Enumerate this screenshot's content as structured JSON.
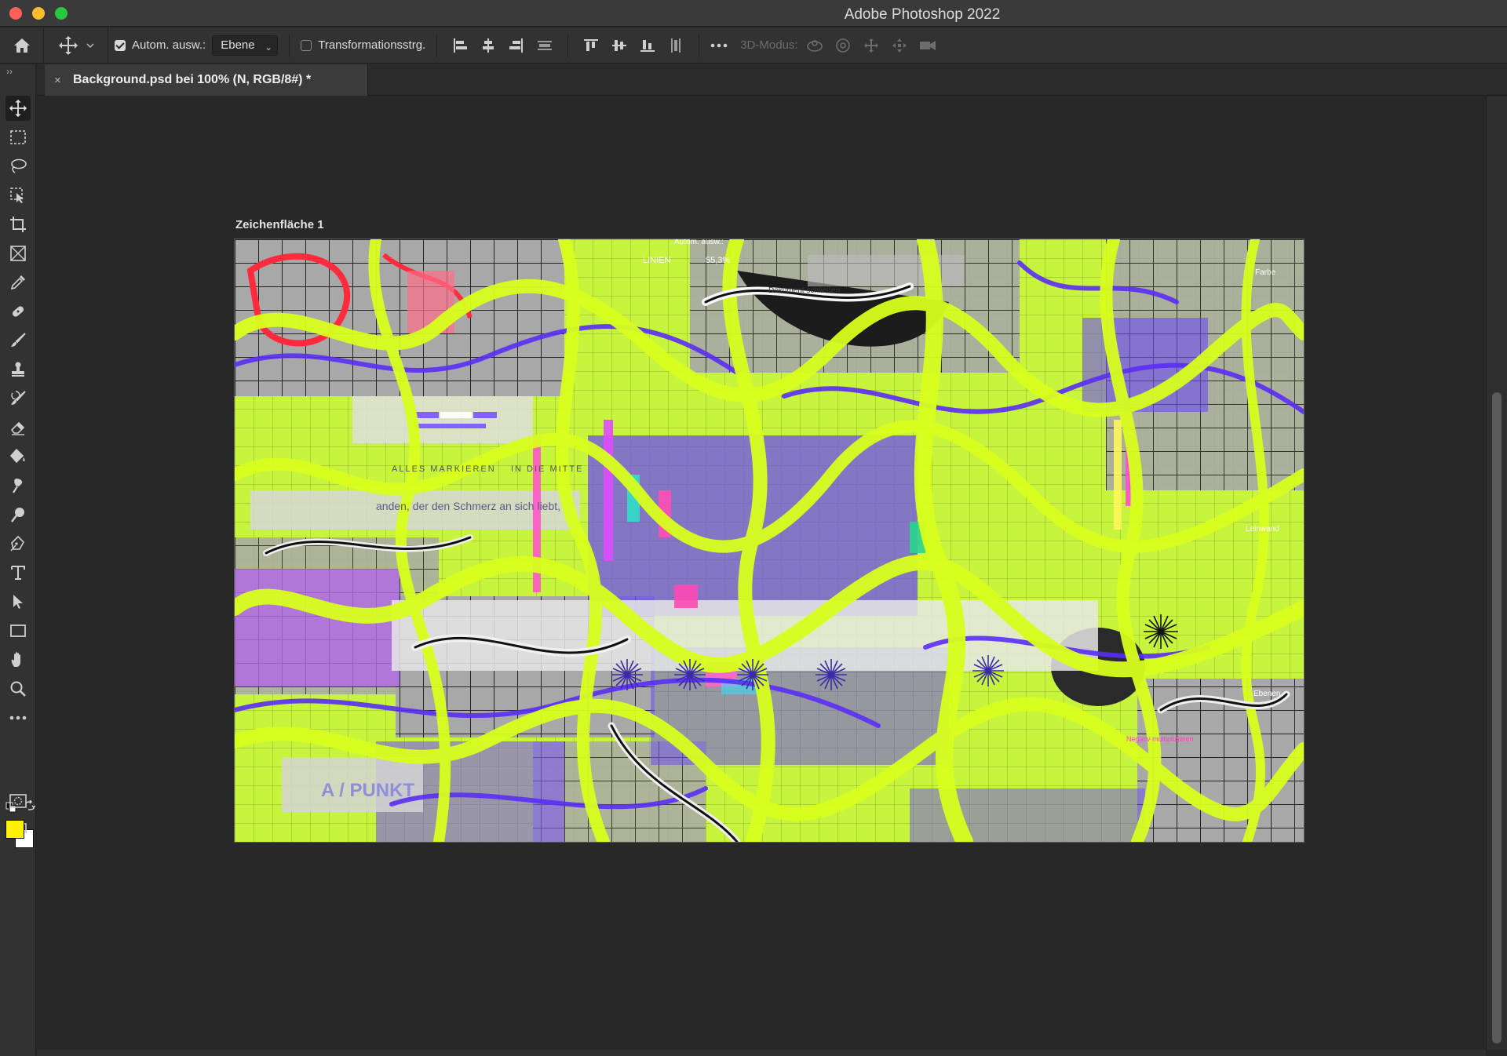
{
  "window": {
    "title": "Adobe Photoshop 2022"
  },
  "options_bar": {
    "auto_select_label": "Autom. ausw.:",
    "auto_select_checked": true,
    "layer_select_value": "Ebene",
    "transform_label": "Transformationsstrg.",
    "transform_checked": false,
    "mode_3d_label": "3D-Modus:"
  },
  "tabs": [
    {
      "label": "Background.psd bei 100% (N, RGB/8#) *",
      "close": "×"
    }
  ],
  "artboard": {
    "name": "Zeichenfläche 1",
    "embedded_texts": [
      "LINIEN",
      "Autom. ausw.:",
      "55,3%",
      "Dokument schließen",
      "ALLES MARKIEREN",
      "IN DIE MITTE",
      "anden, der den Schmerz an sich liebt,",
      "A / PUNKT",
      "Farbe",
      "Leinwand",
      "Ebenen",
      "Negativ multiplizieren"
    ]
  },
  "colors": {
    "foreground": "#fff200",
    "background": "#ffffff",
    "accent_lime": "#c7f53d",
    "accent_purple": "#6c4cf0"
  },
  "tools": [
    "move-icon",
    "marquee-icon",
    "lasso-icon",
    "object-select-icon",
    "crop-icon",
    "frame-icon",
    "eyedropper-icon",
    "healing-icon",
    "brush-icon",
    "stamp-icon",
    "history-brush-icon",
    "eraser-icon",
    "paint-bucket-icon",
    "smudge-icon",
    "dodge-icon",
    "pen-icon",
    "type-icon",
    "path-select-icon",
    "rectangle-icon",
    "hand-icon",
    "zoom-icon",
    "more-tools-icon",
    "quick-mask-icon",
    "screen-mode-icon"
  ]
}
